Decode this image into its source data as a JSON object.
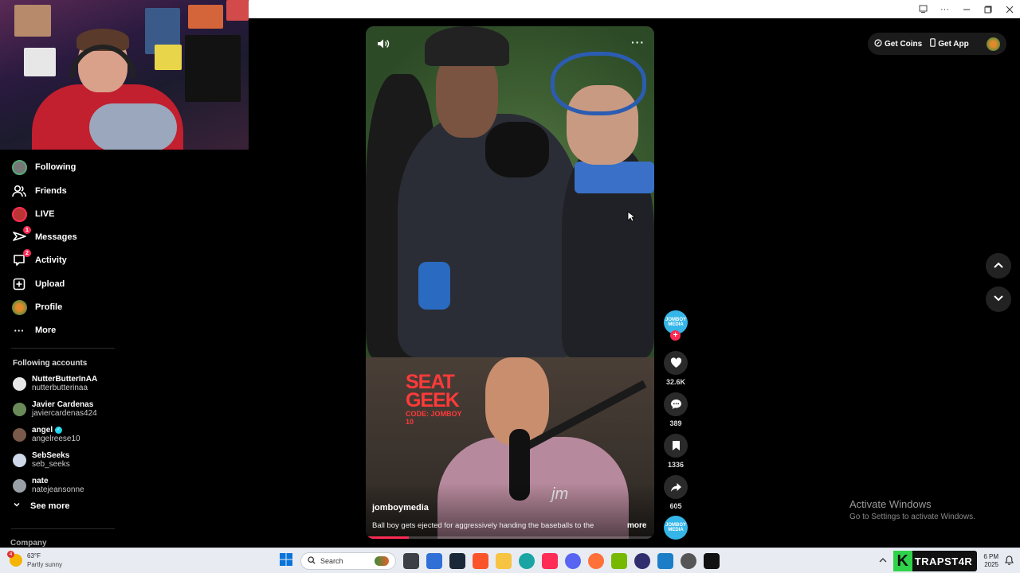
{
  "sidebar": {
    "nav": [
      {
        "label": "Following",
        "icon": "following-avatar-icon",
        "badge": ""
      },
      {
        "label": "Friends",
        "icon": "friends-icon",
        "badge": ""
      },
      {
        "label": "LIVE",
        "icon": "live-avatar-icon",
        "badge": ""
      },
      {
        "label": "Messages",
        "icon": "paper-plane-icon",
        "badge": "1"
      },
      {
        "label": "Activity",
        "icon": "inbox-icon",
        "badge": "2"
      },
      {
        "label": "Upload",
        "icon": "plus-square-icon",
        "badge": ""
      },
      {
        "label": "Profile",
        "icon": "profile-avatar-icon",
        "badge": ""
      },
      {
        "label": "More",
        "icon": "more-dots-icon",
        "badge": ""
      }
    ],
    "following_title": "Following accounts",
    "accounts": [
      {
        "name": "NutterButterInAA",
        "handle": "nutterbutterinaa",
        "verified": false,
        "color": "#e8e8e8"
      },
      {
        "name": "Javier Cardenas",
        "handle": "javiercardenas424",
        "verified": false,
        "color": "#6a8a5a"
      },
      {
        "name": "angel",
        "handle": "angelreese10",
        "verified": true,
        "color": "#7a5a4a"
      },
      {
        "name": "SebSeeks",
        "handle": "seb_seeks",
        "verified": false,
        "color": "#cfd8e8"
      },
      {
        "name": "nate",
        "handle": "natejeansonne",
        "verified": false,
        "color": "#9aa0a8"
      }
    ],
    "see_more": "See more",
    "company": "Company"
  },
  "video": {
    "username": "jomboymedia",
    "caption": "Ball boy gets ejected for aggressively handing the baseballs to the",
    "more_label": "more",
    "sponsor_line1": "SEAT",
    "sponsor_line2": "GEEK",
    "sponsor_code": "CODE: JOMBOY 10",
    "shirt_logo": "jm",
    "progress": 0.15
  },
  "actions": {
    "creator_avatar_text": "JOMBOY MEDIA",
    "likes": "32.6K",
    "comments": "389",
    "saves": "1336",
    "shares": "605"
  },
  "topbar": {
    "get_coins": "Get Coins",
    "get_app": "Get App"
  },
  "watermark": {
    "title": "Activate Windows",
    "subtitle": "Go to Settings to activate Windows."
  },
  "taskbar": {
    "temperature": "63°F",
    "weather_desc": "Partly sunny",
    "weather_badge": "4",
    "search_placeholder": "Search",
    "stream_brand": "TRAPST4R",
    "time": "6 PM",
    "date": "2025"
  },
  "colors": {
    "accent": "#fe2c55",
    "verified": "#20d5ec",
    "stream_brand": "#2fd34a"
  }
}
